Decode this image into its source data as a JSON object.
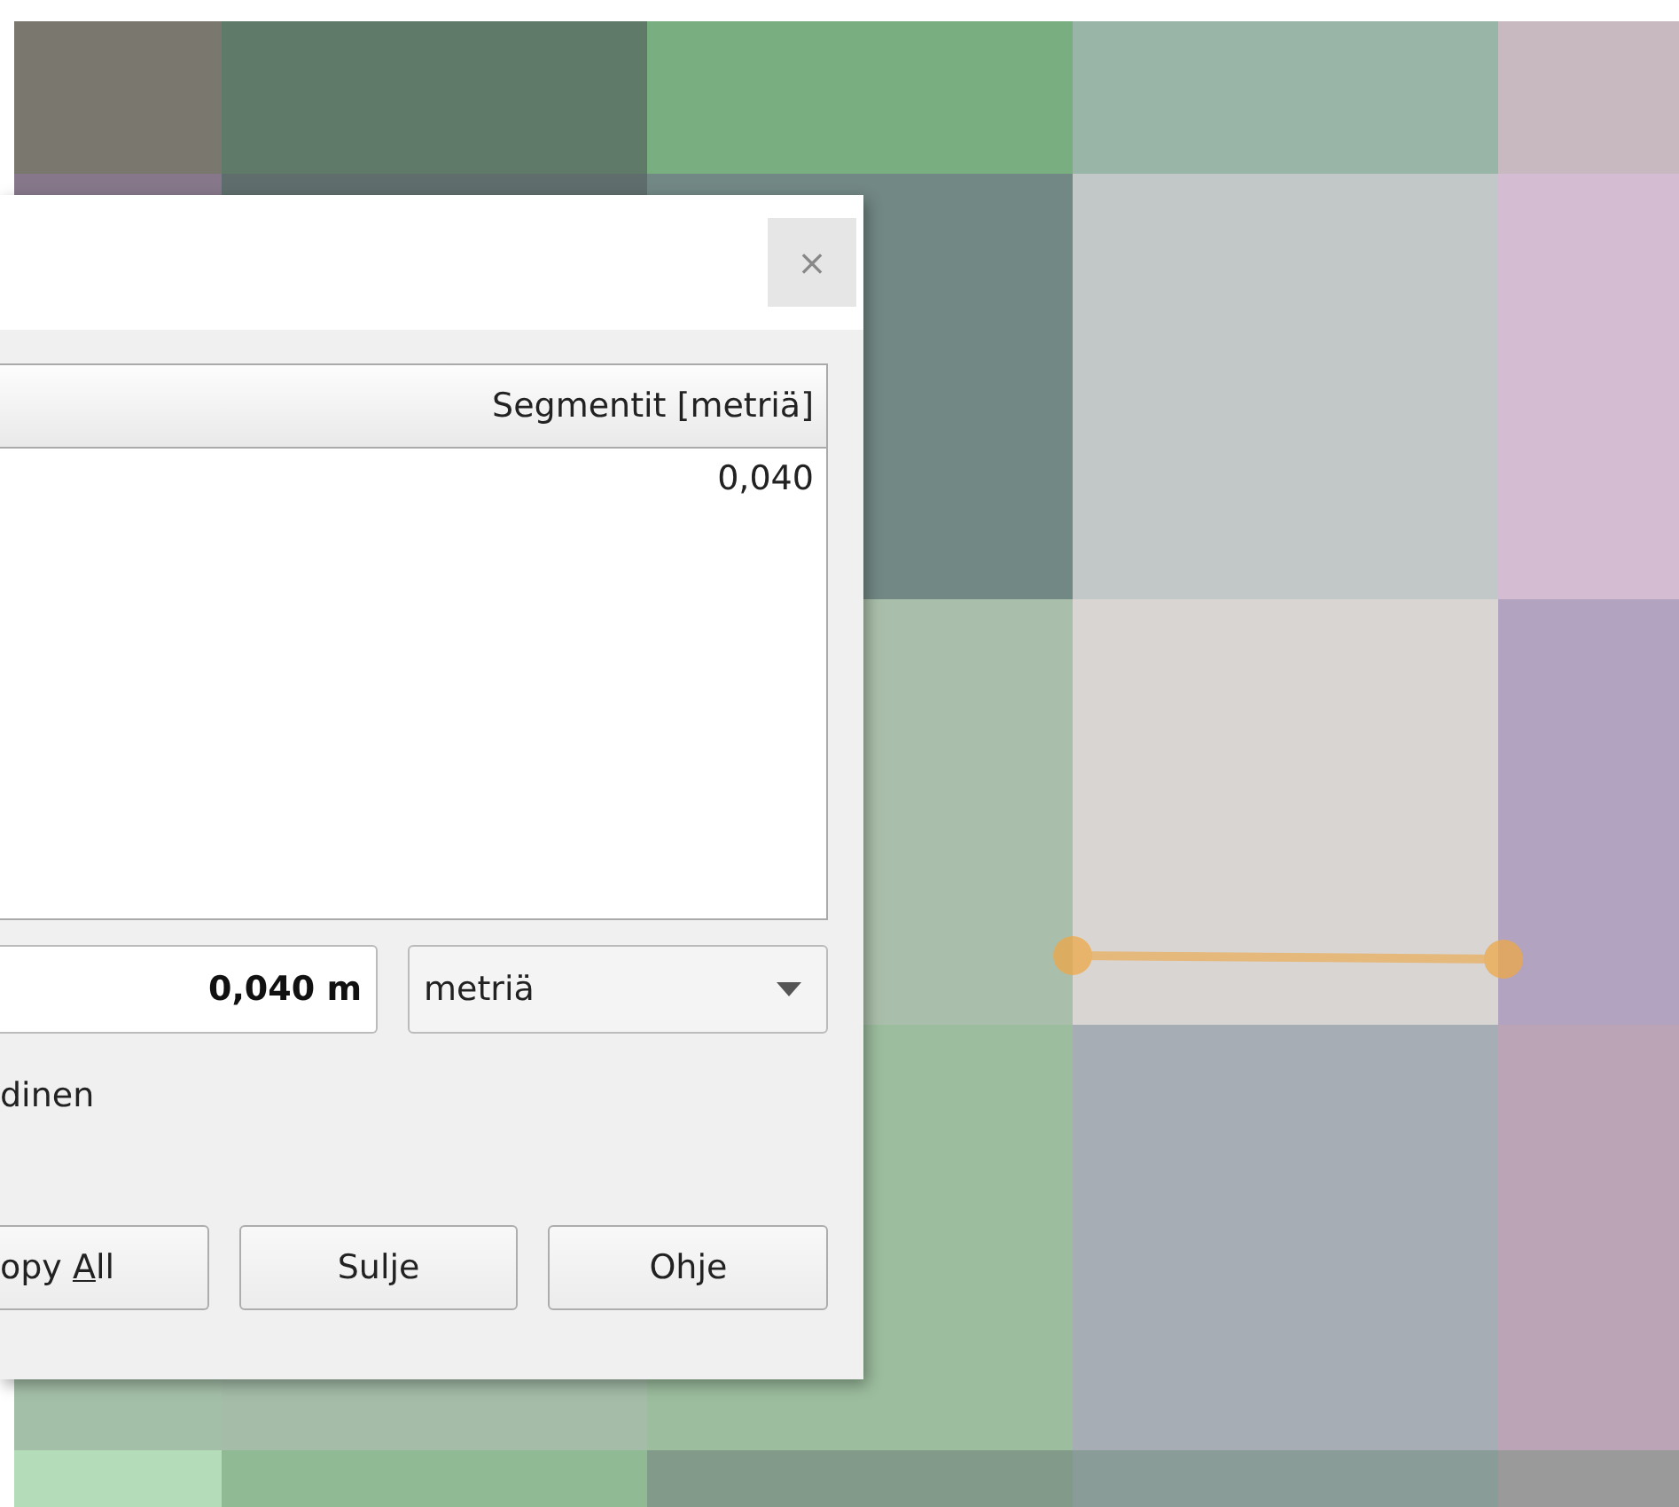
{
  "dialog": {
    "close_button": "×",
    "table": {
      "columns": [
        "Segmentit [metriä]"
      ],
      "rows": [
        [
          "0,040"
        ]
      ]
    },
    "total": {
      "value": "0,040 m"
    },
    "unit_select": {
      "value": "metriä"
    },
    "option_label": "dinen",
    "buttons": [
      {
        "label_parts": [
          "opy ",
          "A",
          "ll"
        ]
      },
      {
        "label_parts": [
          "Sulje"
        ]
      },
      {
        "label_parts": [
          "Ohje"
        ]
      }
    ]
  }
}
